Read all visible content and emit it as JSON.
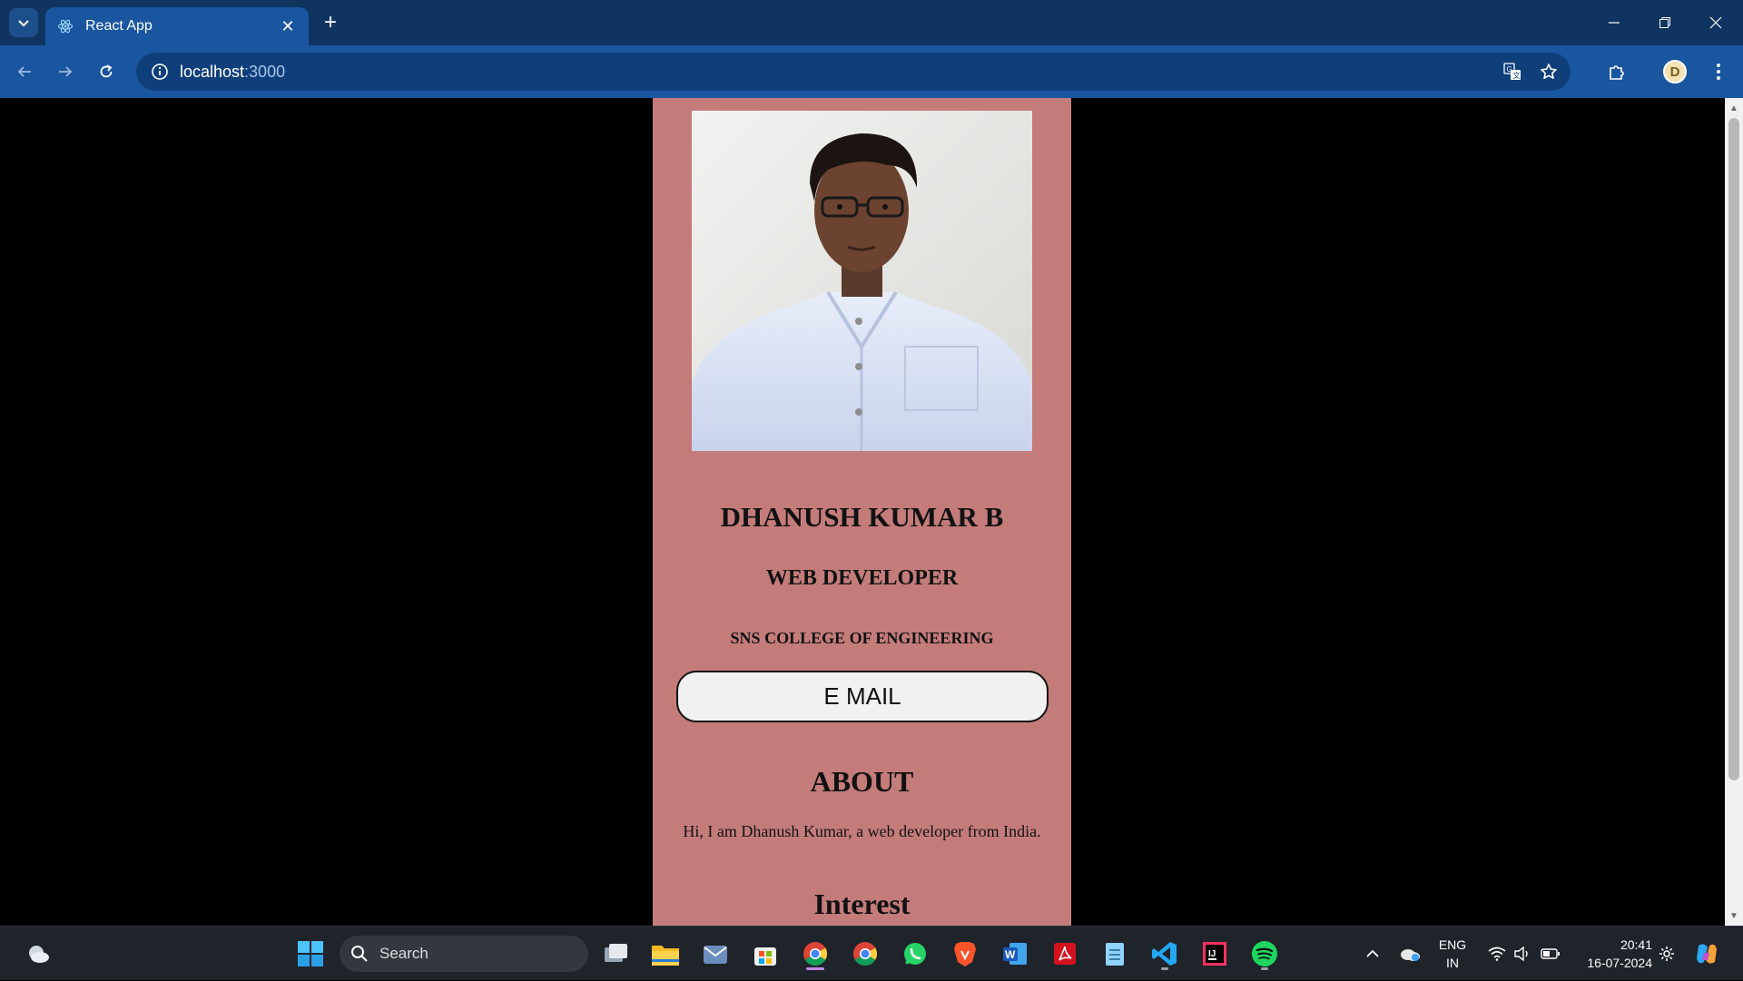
{
  "browser": {
    "tab_title": "React App",
    "url_host": "localhost",
    "url_port": ":3000",
    "tab_close": "✕",
    "new_tab": "+"
  },
  "profile": {
    "name": "DHANUSH KUMAR B",
    "role": "WEB DEVELOPER",
    "college": "SNS COLLEGE OF ENGINEERING",
    "email_button": "E MAIL",
    "about_heading": "ABOUT",
    "about_text": "Hi, I am Dhanush Kumar, a web developer from India.",
    "interest_heading": "Interest",
    "card_color": "#c47c7b"
  },
  "avatar_letter": "D",
  "taskbar": {
    "search_label": "Search",
    "lang_line1": "ENG",
    "lang_line2": "IN",
    "time": "20:41",
    "date": "16-07-2024",
    "apps": [
      "weather-icon",
      "start-icon",
      "task-view-icon",
      "file-explorer-icon",
      "mail-icon",
      "store-icon",
      "chrome-icon",
      "chrome-alt-icon",
      "whatsapp-icon",
      "brave-icon",
      "word-icon",
      "acrobat-icon",
      "notepad-icon",
      "vscode-icon",
      "intellij-icon",
      "spotify-icon"
    ]
  }
}
